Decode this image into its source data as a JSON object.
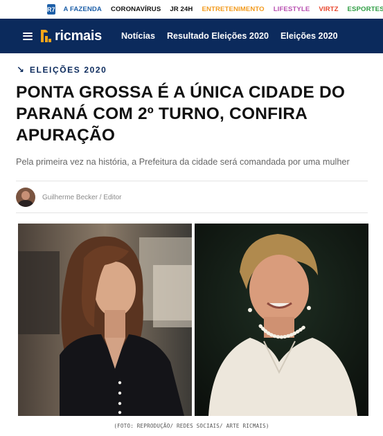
{
  "portal": {
    "logo": "R7",
    "links": [
      {
        "label": "A FAZENDA",
        "color": "#1d5fa8"
      },
      {
        "label": "CORONAVÍRUS",
        "color": "#111111"
      },
      {
        "label": "JR 24H",
        "color": "#111111"
      },
      {
        "label": "ENTRETENIMENTO",
        "color": "#f29a1d"
      },
      {
        "label": "LIFESTYLE",
        "color": "#b84fb1"
      },
      {
        "label": "VIRTZ",
        "color": "#e8452c"
      },
      {
        "label": "ESPORTES",
        "color": "#2f9e44"
      }
    ]
  },
  "header": {
    "menu_icon": "hamburger-icon",
    "logo_text": "ricmais",
    "nav": [
      "Notícias",
      "Resultado Eleições 2020",
      "Eleições 2020"
    ],
    "background": "#0b2a5c",
    "accent": "#f6a51a"
  },
  "article": {
    "kicker": "ELEIÇÕES 2020",
    "title": "PONTA GROSSA É A ÚNICA CIDADE DO PARANÁ COM 2º TURNO, CONFIRA APURAÇÃO",
    "subtitle": "Pela primeira vez na história, a Prefeitura da cidade será comandada por uma mulher",
    "author": "Guilherme Becker / Editor",
    "photo_caption": "(FOTO: REPRODUÇÃO/ REDES SOCIAIS/ ARTE RICMAIS)"
  }
}
